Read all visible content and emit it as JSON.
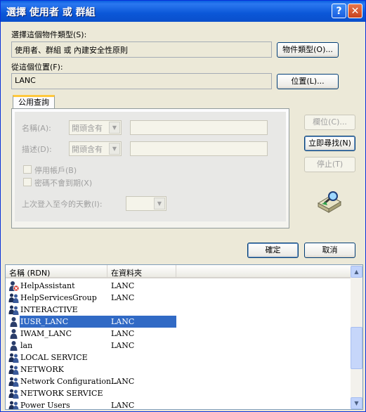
{
  "window": {
    "title": "選擇 使用者 或 群組",
    "help_label": "?",
    "close_label": "✕"
  },
  "object_type": {
    "label": "選擇這個物件類型(S):",
    "value": "使用者、群組 或 內建安全性原則",
    "button": "物件類型(O)..."
  },
  "location": {
    "label": "從這個位置(F):",
    "value": "LANC",
    "button": "位置(L)..."
  },
  "query": {
    "tab": "公用查詢",
    "name_label": "名稱(A):",
    "name_combo": "開頭含有",
    "desc_label": "描述(D):",
    "desc_combo": "開頭含有",
    "disabled_accounts": "停用帳戶(B)",
    "no_expire_pwd": "密碼不會到期(X)",
    "days_label": "上次登入至今的天數(I):"
  },
  "side_buttons": {
    "columns": "欄位(C)...",
    "find_now": "立即尋找(N)",
    "stop": "停止(T)"
  },
  "footer": {
    "ok": "確定",
    "cancel": "取消"
  },
  "results": {
    "columns": [
      "名稱 (RDN)",
      "在資料夾"
    ],
    "rows": [
      {
        "name": "HelpAssistant",
        "folder": "LANC",
        "icon": "disabled-user-icon"
      },
      {
        "name": "HelpServicesGroup",
        "folder": "LANC",
        "icon": "group-icon"
      },
      {
        "name": "INTERACTIVE",
        "folder": "",
        "icon": "group-icon"
      },
      {
        "name": "IUSR_LANC",
        "folder": "LANC",
        "icon": "user-icon",
        "selected": true
      },
      {
        "name": "IWAM_LANC",
        "folder": "LANC",
        "icon": "user-icon"
      },
      {
        "name": "lan",
        "folder": "LANC",
        "icon": "user-icon"
      },
      {
        "name": "LOCAL SERVICE",
        "folder": "",
        "icon": "group-icon"
      },
      {
        "name": "NETWORK",
        "folder": "",
        "icon": "group-icon"
      },
      {
        "name": "Network Configuration...",
        "folder": "LANC",
        "icon": "group-icon"
      },
      {
        "name": "NETWORK SERVICE",
        "folder": "",
        "icon": "group-icon"
      },
      {
        "name": "Power Users",
        "folder": "LANC",
        "icon": "group-icon"
      }
    ]
  },
  "colors": {
    "title_bar": "#0A58DA",
    "selection": "#316AC5",
    "dialog_bg": "#ECE9D8"
  }
}
